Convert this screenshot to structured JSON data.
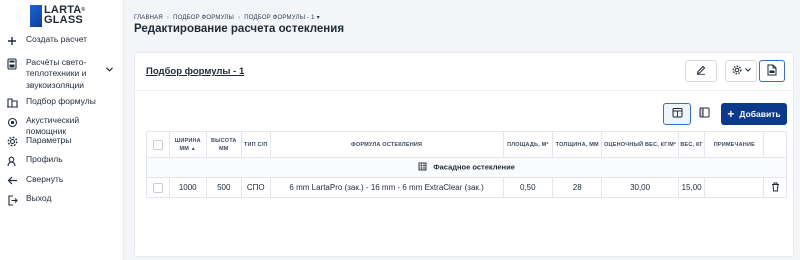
{
  "brand": {
    "line1": "LARTA",
    "line2": "GLASS",
    "reg": "®"
  },
  "sidebar": {
    "items": [
      {
        "icon": "plus-icon",
        "label": "Создать расчет"
      },
      {
        "icon": "calculator-icon",
        "label": "Расчёты свето- теплотехники и звукоизоляции"
      },
      {
        "icon": "building-icon",
        "label": "Подбор формулы"
      },
      {
        "icon": "acoustic-icon",
        "label": "Акустический помощник"
      },
      {
        "icon": "gear-icon",
        "label": "Параметры"
      },
      {
        "icon": "user-icon",
        "label": "Профиль"
      },
      {
        "icon": "arrow-left-icon",
        "label": "Свернуть"
      },
      {
        "icon": "logout-icon",
        "label": "Выход"
      }
    ]
  },
  "breadcrumb": {
    "items": [
      "ГЛАВНАЯ",
      "ПОДБОР ФОРМУЛЫ",
      "ПОДБОР ФОРМУЛЫ - 1"
    ],
    "separator": "›",
    "dropdown": "▾"
  },
  "page": {
    "title": "Редактирование расчета остекления"
  },
  "card": {
    "title": "Подбор формулы - 1",
    "add_button": "Добавить"
  },
  "table": {
    "headers": [
      "ШИРИНА ММ",
      "ВЫСОТА ММ",
      "ТИП С/П",
      "ФОРМУЛА ОСТЕКЛЕНИЯ",
      "ПЛОЩАДЬ, М²",
      "ТОЛЩИНА, ММ",
      "ОЦЕНОЧНЫЙ ВЕС, КГ/М²",
      "ВЕС, КГ",
      "ПРИМЕЧАНИЕ"
    ],
    "sort_indicator": "▲",
    "group": {
      "icon": "facade-icon",
      "label": "Фасадное остекление"
    },
    "rows": [
      {
        "width": "1000",
        "height": "500",
        "type": "СПО",
        "formula": "6 mm LartaPro (зак.) - 16 mm - 6 mm ExtraClear (зак.)",
        "area": "0,50",
        "thickness": "28",
        "est_weight": "30,00",
        "weight": "15,00",
        "note": ""
      }
    ]
  },
  "colors": {
    "primary": "#0b3a8a",
    "accent": "#3a6fc9",
    "background": "#f3f5f8"
  }
}
